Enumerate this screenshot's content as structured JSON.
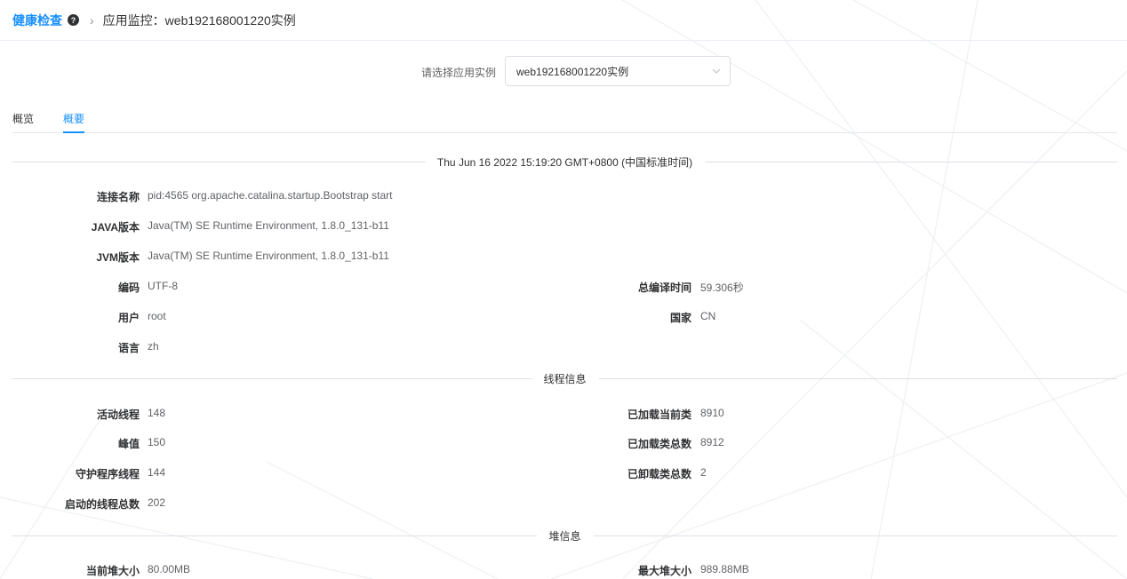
{
  "breadcrumb": {
    "brand": "健康检查",
    "current_prefix": "应用监控：",
    "current_value": "web192168001220实例"
  },
  "selector": {
    "label": "请选择应用实例",
    "value": "web192168001220实例"
  },
  "tabs": [
    {
      "label": "概览",
      "active": false
    },
    {
      "label": "概要",
      "active": true
    }
  ],
  "timestamp": "Thu Jun 16 2022 15:19:20 GMT+0800 (中国标准时间)",
  "basic_info": {
    "connection_name": {
      "label": "连接名称",
      "value": "pid:4565 org.apache.catalina.startup.Bootstrap start"
    },
    "java_version": {
      "label": "JAVA版本",
      "value": "Java(TM) SE Runtime Environment, 1.8.0_131-b11"
    },
    "jvm_version": {
      "label": "JVM版本",
      "value": "Java(TM) SE Runtime Environment, 1.8.0_131-b11"
    },
    "encoding": {
      "label": "编码",
      "value": "UTF-8"
    },
    "total_compile_time": {
      "label": "总编译时间",
      "value": "59.306秒"
    },
    "user": {
      "label": "用户",
      "value": "root"
    },
    "country": {
      "label": "国家",
      "value": "CN"
    },
    "language": {
      "label": "语言",
      "value": "zh"
    }
  },
  "thread_info": {
    "title": "线程信息",
    "active_threads": {
      "label": "活动线程",
      "value": "148"
    },
    "loaded_current_classes": {
      "label": "已加载当前类",
      "value": "8910"
    },
    "peak": {
      "label": "峰值",
      "value": "150"
    },
    "loaded_total_classes": {
      "label": "已加载类总数",
      "value": "8912"
    },
    "daemon_threads": {
      "label": "守护程序线程",
      "value": "144"
    },
    "unloaded_total_classes": {
      "label": "已卸载类总数",
      "value": "2"
    },
    "started_total_threads": {
      "label": "启动的线程总数",
      "value": "202"
    }
  },
  "heap_info": {
    "title": "堆信息",
    "current_heap_size": {
      "label": "当前堆大小",
      "value": "80.00MB"
    },
    "max_heap_size": {
      "label": "最大堆大小",
      "value": "989.88MB"
    }
  },
  "colors": {
    "accent": "#1890ff",
    "text_primary": "#303133",
    "text_regular": "#606266",
    "border": "#dcdfe6"
  }
}
